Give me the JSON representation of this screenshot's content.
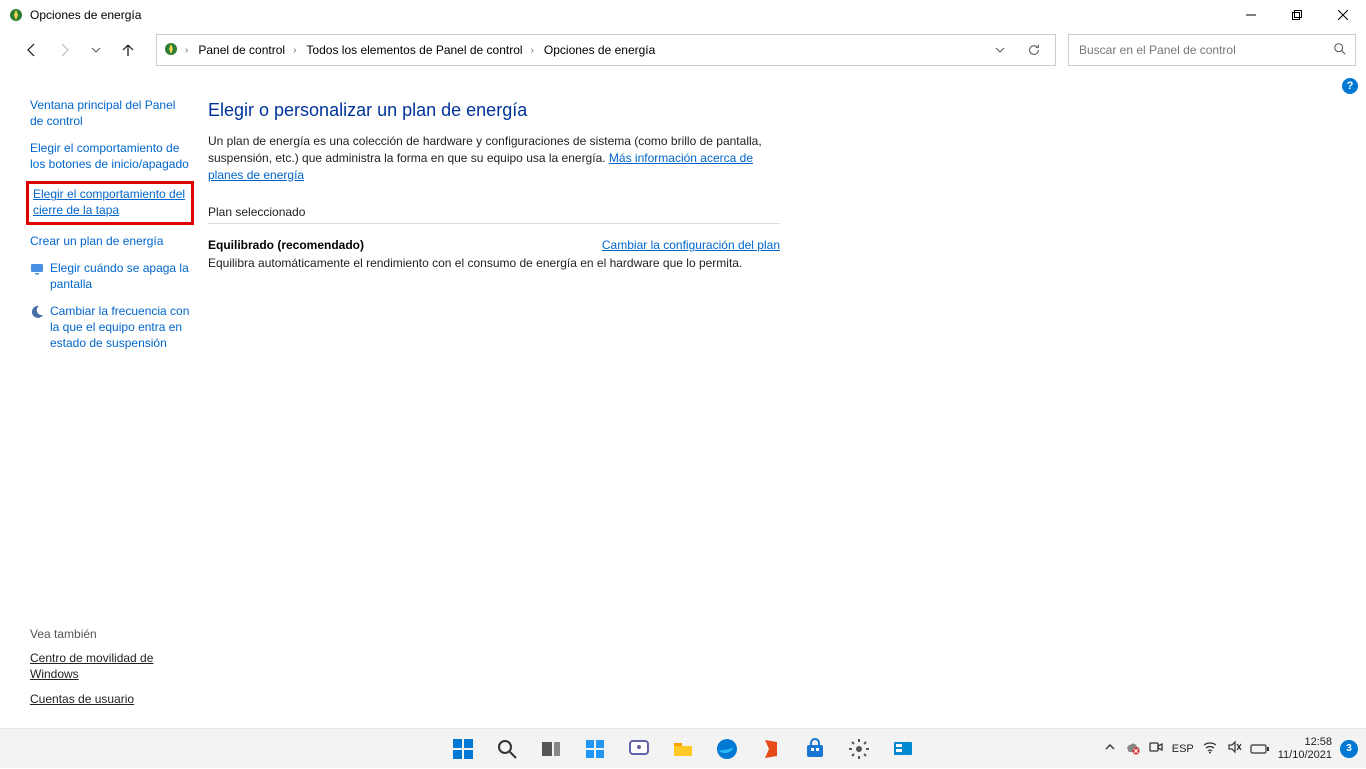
{
  "window": {
    "title": "Opciones de energía"
  },
  "breadcrumb": {
    "item1": "Panel de control",
    "item2": "Todos los elementos de Panel de control",
    "item3": "Opciones de energía"
  },
  "search": {
    "placeholder": "Buscar en el Panel de control"
  },
  "sidebar": {
    "link_main": "Ventana principal del Panel de control",
    "link_buttons": "Elegir el comportamiento de los botones de inicio/apagado",
    "link_lid": "Elegir el comportamiento del cierre de la tapa",
    "link_create": "Crear un plan de energía",
    "link_when_off": "Elegir cuándo se apaga la pantalla",
    "link_sleep": "Cambiar la frecuencia con la que el equipo entra en estado de suspensión",
    "see_also": "Vea también",
    "see_mobility": "Centro de movilidad de Windows",
    "see_accounts": "Cuentas de usuario"
  },
  "main": {
    "heading": "Elegir o personalizar un plan de energía",
    "desc_pre": "Un plan de energía es una colección de hardware y configuraciones de sistema (como brillo de pantalla, suspensión, etc.) que administra la forma en que su equipo usa la energía. ",
    "desc_link": "Más información acerca de planes de energía",
    "section": "Plan seleccionado",
    "plan_name": "Equilibrado (recomendado)",
    "plan_link": "Cambiar la configuración del plan",
    "plan_desc": "Equilibra automáticamente el rendimiento con el consumo de energía en el hardware que lo permita."
  },
  "help": {
    "char": "?"
  },
  "taskbar": {
    "lang": "ESP",
    "time": "12:58",
    "date": "11/10/2021",
    "notif_count": "3"
  }
}
